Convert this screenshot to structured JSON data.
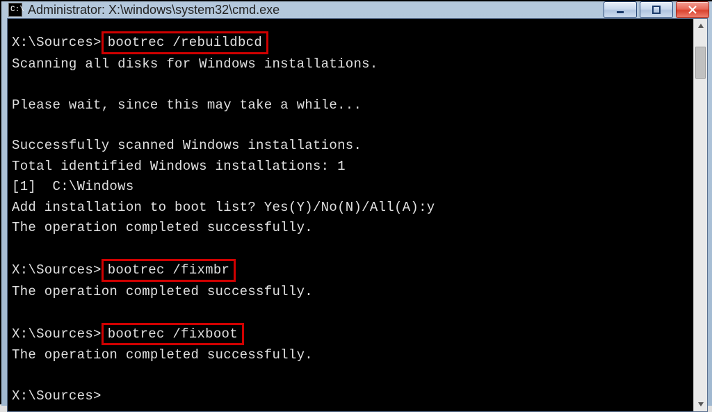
{
  "titlebar": {
    "icon_label": "C:\\",
    "title": "Administrator: X:\\windows\\system32\\cmd.exe"
  },
  "terminal": {
    "l1_prompt": "X:\\Sources>",
    "l1_cmd": "bootrec /rebuildbcd",
    "l2": "Scanning all disks for Windows installations.",
    "l3": "Please wait, since this may take a while...",
    "l4": "Successfully scanned Windows installations.",
    "l5": "Total identified Windows installations: 1",
    "l6": "[1]  C:\\Windows",
    "l7": "Add installation to boot list? Yes(Y)/No(N)/All(A):y",
    "l8": "The operation completed successfully.",
    "l9_prompt": "X:\\Sources>",
    "l9_cmd": "bootrec /fixmbr",
    "l10": "The operation completed successfully.",
    "l11_prompt": "X:\\Sources>",
    "l11_cmd": "bootrec /fixboot",
    "l12": "The operation completed successfully.",
    "l13": "X:\\Sources>"
  }
}
